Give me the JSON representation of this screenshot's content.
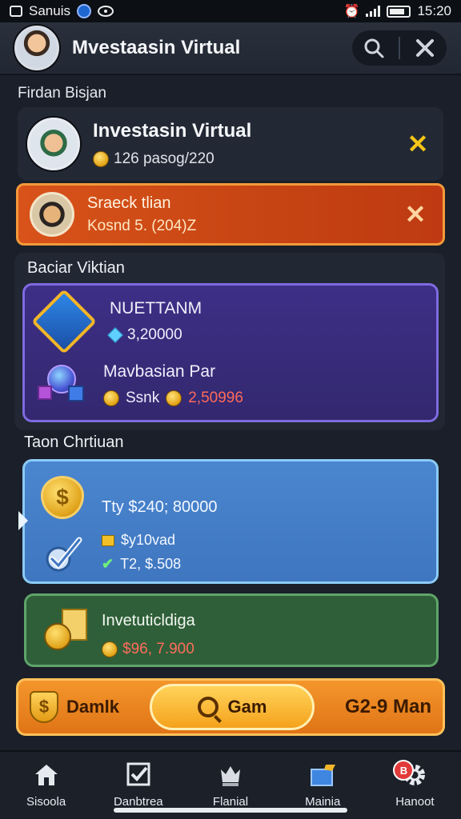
{
  "status_bar": {
    "app_name": "Sanuis",
    "time": "15:20"
  },
  "header": {
    "title": "Mvestaasin Virtual",
    "search_icon": "search-icon",
    "close_icon": "close-icon"
  },
  "section1_label": "Firdan Bisjan",
  "profile": {
    "name": "Investasin Virtual",
    "balance": "126 pasog/220",
    "close_icon": "close-icon"
  },
  "alert": {
    "title": "Sraeck tlian",
    "subtitle": "Kosnd 5. (204)Z",
    "close_icon": "close-icon"
  },
  "investments": {
    "title": "Baciar Viktian",
    "items": [
      {
        "title": "NUETTANM",
        "value": "3,20000"
      },
      {
        "title": "Mavbasian Par",
        "value_a": "Ssnk",
        "value_b": "2,50996"
      }
    ]
  },
  "section2_label": "Taon Chrtiuan",
  "blue_card": {
    "line1": "Tty $240; 80000",
    "line2": "$y10vad",
    "line3": "T2, $.508"
  },
  "green_card": {
    "title": "Invetuticldiga",
    "value": "$96, 7.900"
  },
  "action_bar": {
    "left_label": "Damlk",
    "center_label": "Gam",
    "right_label": "G2-9 Man"
  },
  "colors": {
    "accent_orange": "#e07416",
    "accent_purple": "#7f6ae0",
    "accent_blue": "#4a86cf",
    "accent_green": "#2f5f38",
    "alert_red": "#c64413"
  },
  "nav": {
    "items": [
      {
        "label": "Sisoola",
        "icon": "home-icon"
      },
      {
        "label": "Danbtrea",
        "icon": "checkbox-icon"
      },
      {
        "label": "Flanial",
        "icon": "trophy-icon"
      },
      {
        "label": "Mainia",
        "icon": "chest-icon"
      },
      {
        "label": "Hanoot",
        "icon": "gear-icon"
      }
    ],
    "badge": "B"
  }
}
